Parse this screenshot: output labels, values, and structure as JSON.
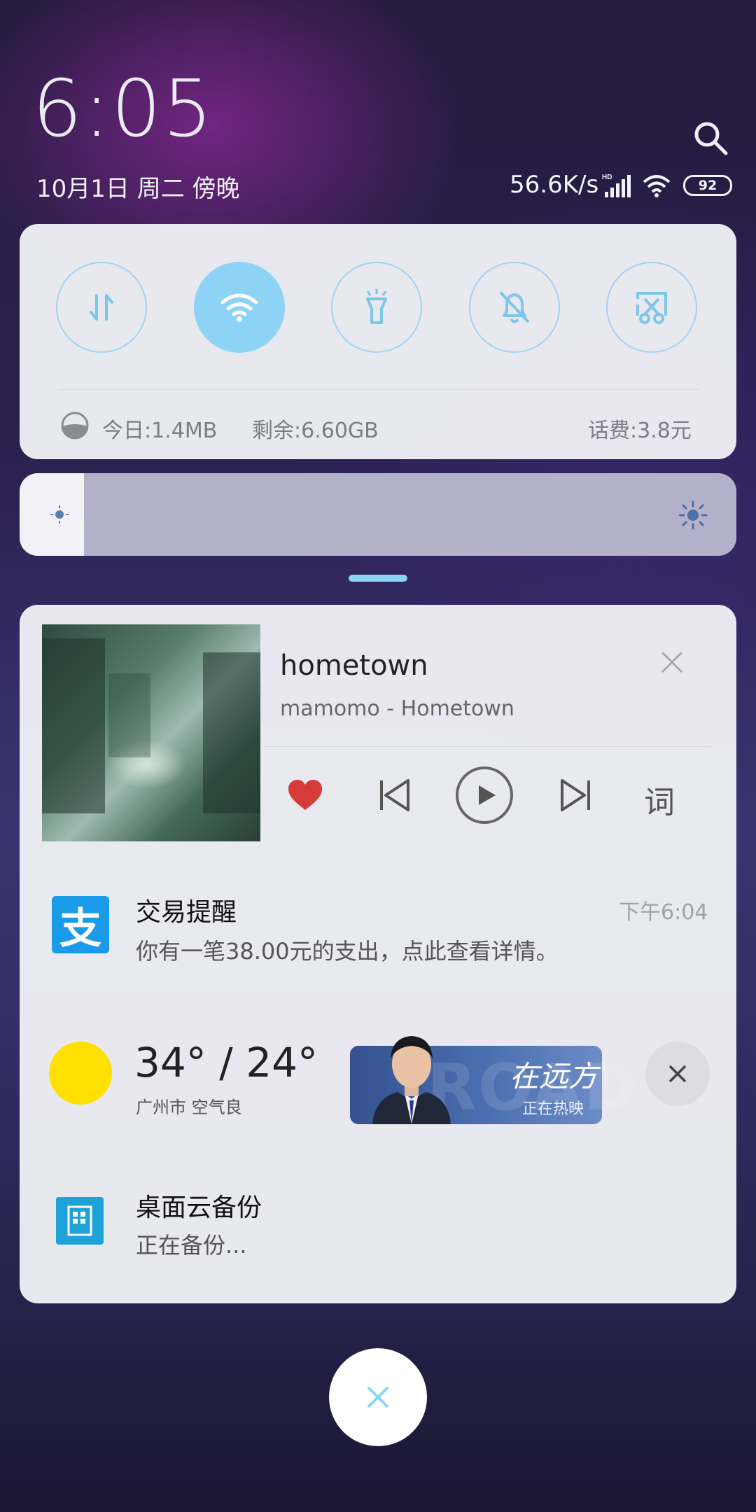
{
  "status": {
    "time": "6:05",
    "date": "10月1日 周二 傍晚",
    "net_speed": "56.6K/s",
    "battery": "92"
  },
  "quick_toggles": {
    "items": [
      {
        "name": "mobile-data",
        "icon": "data-arrows-icon",
        "active": false
      },
      {
        "name": "wifi",
        "icon": "wifi-icon",
        "active": true
      },
      {
        "name": "flashlight",
        "icon": "flashlight-icon",
        "active": false
      },
      {
        "name": "silent",
        "icon": "bell-off-icon",
        "active": false
      },
      {
        "name": "screenshot",
        "icon": "scissors-icon",
        "active": false
      }
    ],
    "usage_today": "今日:1.4MB",
    "remaining": "剩余:6.60GB",
    "balance": "话费:3.8元"
  },
  "brightness": {
    "level": 0.09
  },
  "music": {
    "title": "hometown",
    "artist": "mamomo - Hometown",
    "lyric_label": "词",
    "accent": "#d63a3a"
  },
  "notifications": {
    "alipay": {
      "title": "交易提醒",
      "body": "你有一笔38.00元的支出，点此查看详情。",
      "time": "下午6:04",
      "icon_char": "支"
    },
    "weather": {
      "temp": "34° / 24°",
      "city": "广州市 空气良",
      "banner_title": "在远方",
      "banner_sub": "正在热映"
    },
    "backup": {
      "title": "桌面云备份",
      "body": "正在备份..."
    }
  },
  "colors": {
    "toggle_active": "#8dd3f5",
    "alipay_blue": "#1a9be8",
    "sun": "#ffe000"
  }
}
